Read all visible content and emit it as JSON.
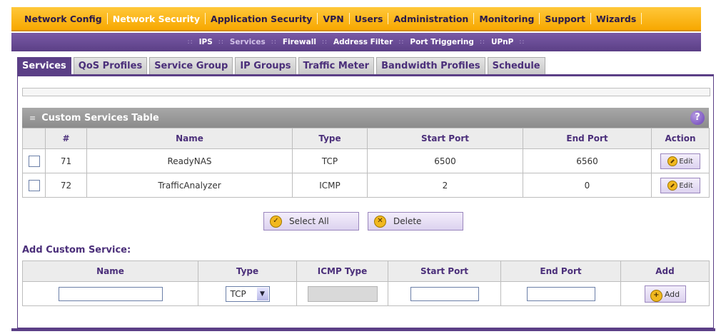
{
  "top_nav": [
    "Network Config",
    "Network Security",
    "Application Security",
    "VPN",
    "Users",
    "Administration",
    "Monitoring",
    "Support",
    "Wizards"
  ],
  "top_nav_active": 1,
  "sub_nav": [
    "IPS",
    "Services",
    "Firewall",
    "Address Filter",
    "Port Triggering",
    "UPnP"
  ],
  "sub_nav_active": 1,
  "tabs": [
    "Services",
    "QoS Profiles",
    "Service Group",
    "IP Groups",
    "Traffic Meter",
    "Bandwidth Profiles",
    "Schedule"
  ],
  "tabs_active": 0,
  "panel": {
    "title": "Custom Services Table",
    "help": "?"
  },
  "table": {
    "headers": [
      "#",
      "Name",
      "Type",
      "Start Port",
      "End Port",
      "Action"
    ],
    "rows": [
      {
        "num": "71",
        "name": "ReadyNAS",
        "type": "TCP",
        "start": "6500",
        "end": "6560",
        "action": "Edit"
      },
      {
        "num": "72",
        "name": "TrafficAnalyzer",
        "type": "ICMP",
        "start": "2",
        "end": "0",
        "action": "Edit"
      }
    ]
  },
  "buttons": {
    "select_all": "Select All",
    "delete": "Delete"
  },
  "add": {
    "label": "Add Custom Service:",
    "headers": [
      "Name",
      "Type",
      "ICMP Type",
      "Start Port",
      "End Port",
      "Add"
    ],
    "type_value": "TCP",
    "button": "Add"
  },
  "colors": {
    "orange": "#f7a800",
    "purple": "#5b3f86",
    "gray_header": "#999999"
  }
}
